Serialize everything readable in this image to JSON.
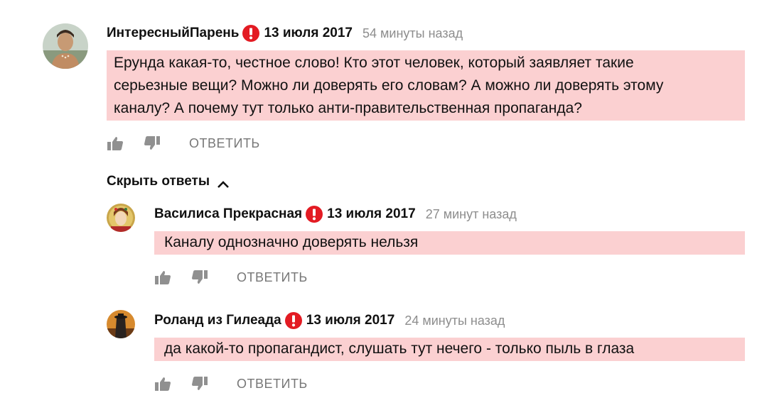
{
  "comments": [
    {
      "author": "ИнтересныйПарень",
      "date": "13 июля 2017",
      "ago": "54 минуты назад",
      "lines": [
        "Ерунда какая-то, честное слово! Кто этот человек, который заявляет такие",
        "серьезные вещи? Можно ли доверять его словам? А можно ли доверять этому",
        "каналу? А почему тут только анти-правительственная пропаганда?"
      ],
      "reply_label": "ОТВЕТИТЬ",
      "avatar_icon": "man-portrait-avatar"
    }
  ],
  "hide_replies_label": "Скрыть ответы",
  "replies": [
    {
      "author": "Василиса Прекрасная",
      "date": "13 июля 2017",
      "ago": "27 минут назад",
      "text": "Каналу однозначно доверять нельзя",
      "reply_label": "ОТВЕТИТЬ",
      "avatar_icon": "woman-portrait-avatar"
    },
    {
      "author": "Роланд из Гилеада",
      "date": "13 июля 2017",
      "ago": "24 минуты назад",
      "text": "да какой-то пропагандист, слушать тут нечего - только пыль в глаза",
      "reply_label": "ОТВЕТИТЬ",
      "avatar_icon": "gunslinger-avatar"
    }
  ],
  "colors": {
    "highlight": "#fbd0d1",
    "alert": "#e31b23",
    "muted": "#8d8d8d",
    "icon": "#909090"
  }
}
